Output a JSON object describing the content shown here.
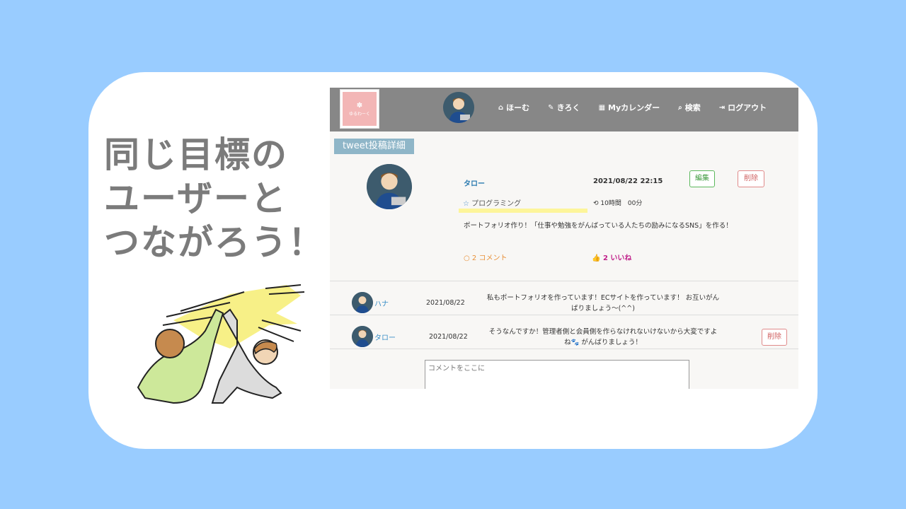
{
  "headline": {
    "line1": "同じ目標の",
    "line2": "ユーザーと",
    "line3": "つながろう！"
  },
  "app": {
    "logo_mark": "✽",
    "logo_text": "ゆるわーく",
    "nav": [
      {
        "icon": "home-icon",
        "glyph": "⌂",
        "label": "ほーむ"
      },
      {
        "icon": "edit-icon",
        "glyph": "✎",
        "label": "きろく"
      },
      {
        "icon": "calendar-icon",
        "glyph": "▦",
        "label": "Myカレンダー"
      },
      {
        "icon": "search-icon",
        "glyph": "⌕",
        "label": "検索"
      },
      {
        "icon": "logout-icon",
        "glyph": "⇥",
        "label": "ログアウト"
      }
    ]
  },
  "section_title": "tweet投稿詳細",
  "post": {
    "user": "タロー",
    "datetime": "2021/08/22 22:15",
    "edit_label": "編集",
    "delete_label": "削除",
    "tag_glyph": "☆",
    "tag": "プログラミング",
    "time_glyph": "⟲",
    "time": "10時間　00分",
    "body": "ポートフォリオ作り！「仕事や勉強をがんばっている人たちの励みになるSNS」を作る！",
    "comments_glyph": "○",
    "comments": "2 コメント",
    "likes_glyph": "👍",
    "likes": "2 いいね"
  },
  "comments": [
    {
      "user": "ハナ",
      "date": "2021/08/22",
      "text_line1": "私もポートフォリオを作っています！ECサイトを作っています！ お互いがん",
      "text_line2": "ばりましょう〜(^^)"
    },
    {
      "user": "タロー",
      "date": "2021/08/22",
      "text_line1": "そうなんですか！管理者側と会員側を作らなけれないけないから大変ですよ",
      "text_line2": "ね🐾 がんばりましょう！",
      "delete_label": "削除"
    }
  ],
  "comment_input": {
    "placeholder": "コメントをここに"
  },
  "colors": {
    "background": "#99ccff",
    "headline": "#7b7b7b",
    "navbar": "#878787",
    "link": "#2a7ab0",
    "tag_highlight": "#fdf59a",
    "comments": "#e8913a",
    "likes": "#c0208a"
  }
}
